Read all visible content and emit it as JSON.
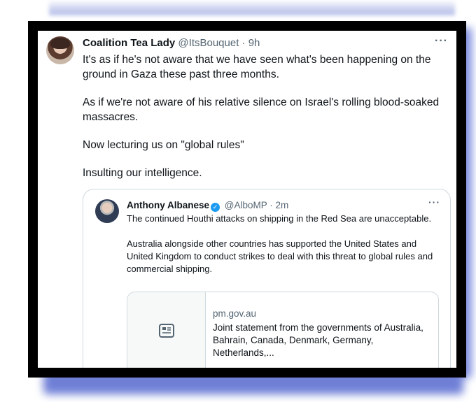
{
  "tweet": {
    "author_name": "Coalition Tea Lady",
    "author_handle": "@ItsBouquet",
    "separator": "·",
    "time": "9h",
    "more_icon": "···",
    "paragraphs": [
      "It's as if he's not aware that we have seen what's been happening on the ground in Gaza these past three months.",
      "As if we're not aware of his relative silence on Israel's rolling blood-soaked massacres.",
      "Now lecturing us on \"global rules\"",
      "Insulting our intelligence."
    ]
  },
  "quoted_tweet": {
    "author_name": "Anthony Albanese",
    "verified_icon": "✓",
    "author_handle": "@AlboMP",
    "separator": "·",
    "time": "2m",
    "more_icon": "···",
    "paragraphs": [
      "The continued Houthi attacks on shipping in the Red Sea are unacceptable.",
      "Australia alongside other countries has supported the United States and United Kingdom to conduct strikes to deal with this threat to global rules and commercial shipping."
    ],
    "link_card": {
      "domain": "pm.gov.au",
      "title": "Joint statement from the governments of Australia, Bahrain, Canada, Denmark, Germany, Netherlands,...",
      "thumbnail_icon": "article-icon"
    }
  },
  "colors": {
    "text_primary": "#0f1419",
    "text_secondary": "#536471",
    "verified_blue": "#1d9bf0",
    "border": "#cfd9de",
    "frame": "#000000",
    "shadow": "#6f7fd6"
  }
}
